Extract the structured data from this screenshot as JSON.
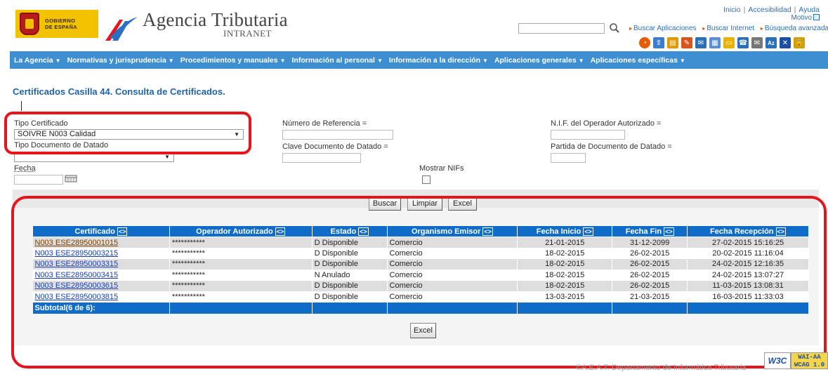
{
  "header": {
    "gov_logo_text_1": "GOBIERNO",
    "gov_logo_text_2": "DE ESPAÑA",
    "agency_title": "Agencia Tributaria",
    "agency_subtitle": "INTRANET",
    "top_links": [
      "Inicio",
      "Accesibilidad",
      "Ayuda"
    ],
    "motivo_label": "Motivo",
    "search_input_value": "",
    "search_links": [
      "Buscar Aplicaciones",
      "Buscar Internet",
      "Búsqueda avanzada"
    ],
    "toolbar_icons": [
      "chart-icon",
      "upload-icon",
      "document-icon",
      "notes-icon",
      "chat-icon",
      "presentation-icon",
      "folder-icon",
      "phone-icon",
      "mail-icon",
      "sort-az-icon",
      "tools-icon",
      "lock-icon"
    ]
  },
  "nav": {
    "items": [
      "La Agencia",
      "Normativas y jurisprudencia",
      "Procedimientos y manuales",
      "Información al personal",
      "Información a la dirección",
      "Aplicaciones generales",
      "Aplicaciones específicas"
    ]
  },
  "page": {
    "title": "Certificados Casilla 44. Consulta de Certificados."
  },
  "form": {
    "tipo_certificado_label": "Tipo Certificado",
    "tipo_certificado_value": "SOIVRE N003 Calidad",
    "tipo_documento_label": "Tipo Documento de Datado",
    "tipo_documento_value": "",
    "numero_referencia_label": "Número de Referencia =",
    "numero_referencia_value": "",
    "clave_documento_label": "Clave Documento de Datado =",
    "clave_documento_value": "",
    "nif_label": "N.I.F. del Operador Autorizado =",
    "nif_value": "",
    "partida_label": "Partida de Documento de Datado =",
    "partida_value": "",
    "fecha_label": "Fecha",
    "fecha_value": "",
    "mostrar_nifs_label": "Mostrar NIFs",
    "mostrar_nifs_checked": false
  },
  "actions": {
    "buscar": "Buscar",
    "limpiar": "Limpiar",
    "excel_top": "Excel",
    "excel_bottom": "Excel"
  },
  "table": {
    "sort_glyph": "<>",
    "columns": [
      "Certificado",
      "Operador Autorizado",
      "Estado",
      "Organismo Emisor",
      "Fecha Inicio",
      "Fecha Fin",
      "Fecha Recepción"
    ],
    "rows": [
      [
        "N003 ESE28950001015",
        "***********",
        "D Disponible",
        "Comercio",
        "21-01-2015",
        "31-12-2099",
        "27-02-2015 15:16:25"
      ],
      [
        "N003 ESE28950003215",
        "***********",
        "D Disponible",
        "Comercio",
        "18-02-2015",
        "26-02-2015",
        "20-02-2015 11:16:04"
      ],
      [
        "N003 ESE28950003315",
        "***********",
        "D Disponible",
        "Comercio",
        "18-02-2015",
        "26-02-2015",
        "24-02-2015 12:16:35"
      ],
      [
        "N003 ESE28950003415",
        "***********",
        "N Anulado",
        "Comercio",
        "18-02-2015",
        "26-02-2015",
        "24-02-2015 13:07:27"
      ],
      [
        "N003 ESE28950003615",
        "***********",
        "D Disponible",
        "Comercio",
        "18-02-2015",
        "26-02-2015",
        "11-03-2015 13:08:31"
      ],
      [
        "N003 ESE28950003815",
        "***********",
        "D Disponible",
        "Comercio",
        "13-03-2015",
        "21-03-2015",
        "16-03-2015 11:33:03"
      ]
    ],
    "subtotal_label": "Subtotal(6 de 6):"
  },
  "footer": {
    "text": "©A.E.A.T. Departamento de Informática Tributaria",
    "w3c": "W3C",
    "wai_1": "WAI-AA",
    "wai_2": "WCAG 1.0"
  },
  "colors": {
    "nav_blue": "#3d8fd2",
    "table_header_blue": "#0f6cc8",
    "title_blue": "#1f63a8",
    "highlight_red": "#e8141c",
    "link_blue": "#1c3fb0"
  }
}
